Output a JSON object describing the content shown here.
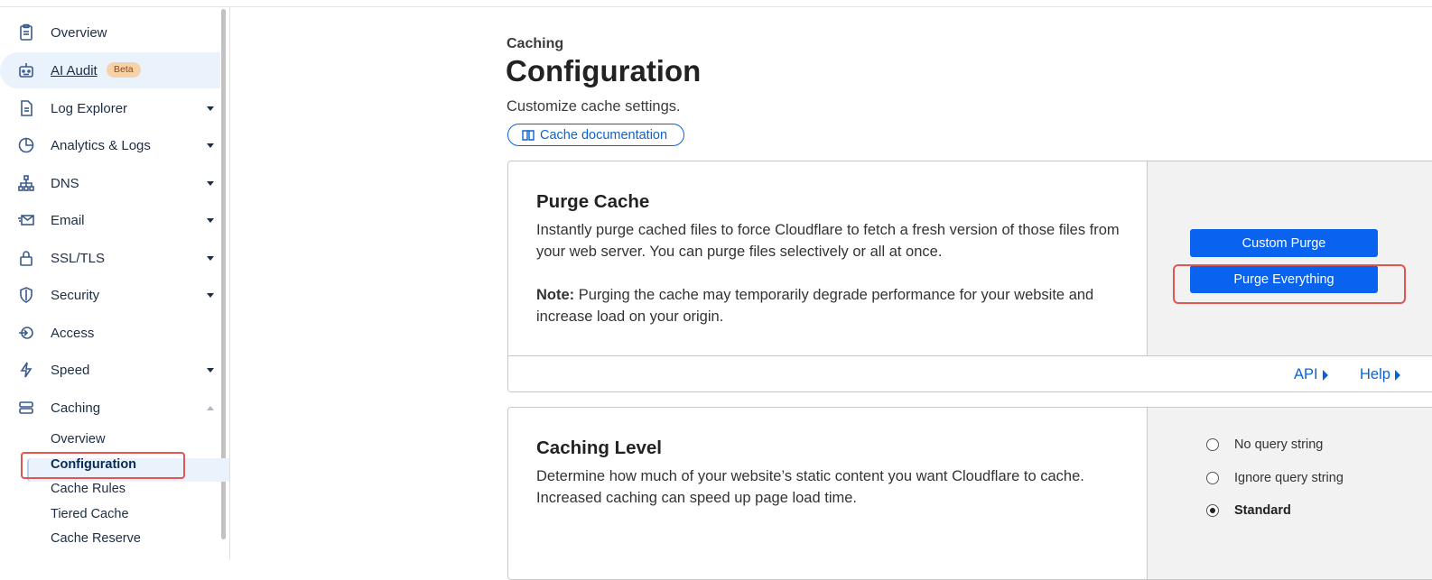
{
  "sidebar": {
    "items": [
      {
        "label": "Overview",
        "icon": "clipboard-icon"
      },
      {
        "label": "AI Audit",
        "icon": "robot-icon",
        "badge": "Beta"
      },
      {
        "label": "Log Explorer",
        "icon": "log-file-icon"
      },
      {
        "label": "Analytics & Logs",
        "icon": "pie-chart-icon"
      },
      {
        "label": "DNS",
        "icon": "network-icon"
      },
      {
        "label": "Email",
        "icon": "email-icon"
      },
      {
        "label": "SSL/TLS",
        "icon": "lock-icon"
      },
      {
        "label": "Security",
        "icon": "shield-icon"
      },
      {
        "label": "Access",
        "icon": "access-icon"
      },
      {
        "label": "Speed",
        "icon": "lightning-icon"
      },
      {
        "label": "Caching",
        "icon": "storage-icon"
      }
    ],
    "caching_sub": [
      "Overview",
      "Configuration",
      "Cache Rules",
      "Tiered Cache",
      "Cache Reserve"
    ]
  },
  "header": {
    "breadcrumb": "Caching",
    "title": "Configuration",
    "subtitle": "Customize cache settings.",
    "doc_link": "Cache documentation"
  },
  "purge_card": {
    "title": "Purge Cache",
    "description": "Instantly purge cached files to force Cloudflare to fetch a fresh version of those files from your web server. You can purge files selectively or all at once.",
    "note_label": "Note:",
    "note_text": " Purging the cache may temporarily degrade performance for your website and increase load on your origin.",
    "custom_purge": "Custom Purge",
    "purge_everything": "Purge Everything",
    "api_link": "API",
    "help_link": "Help"
  },
  "caching_level_card": {
    "title": "Caching Level",
    "description": "Determine how much of your website’s static content you want Cloudflare to cache. Increased caching can speed up page load time.",
    "options": [
      "No query string",
      "Ignore query string",
      "Standard"
    ],
    "selected": "Standard"
  },
  "colors": {
    "accent": "#0a63ee",
    "highlight": "#e25552",
    "beta_bg": "#f7d2a8"
  }
}
